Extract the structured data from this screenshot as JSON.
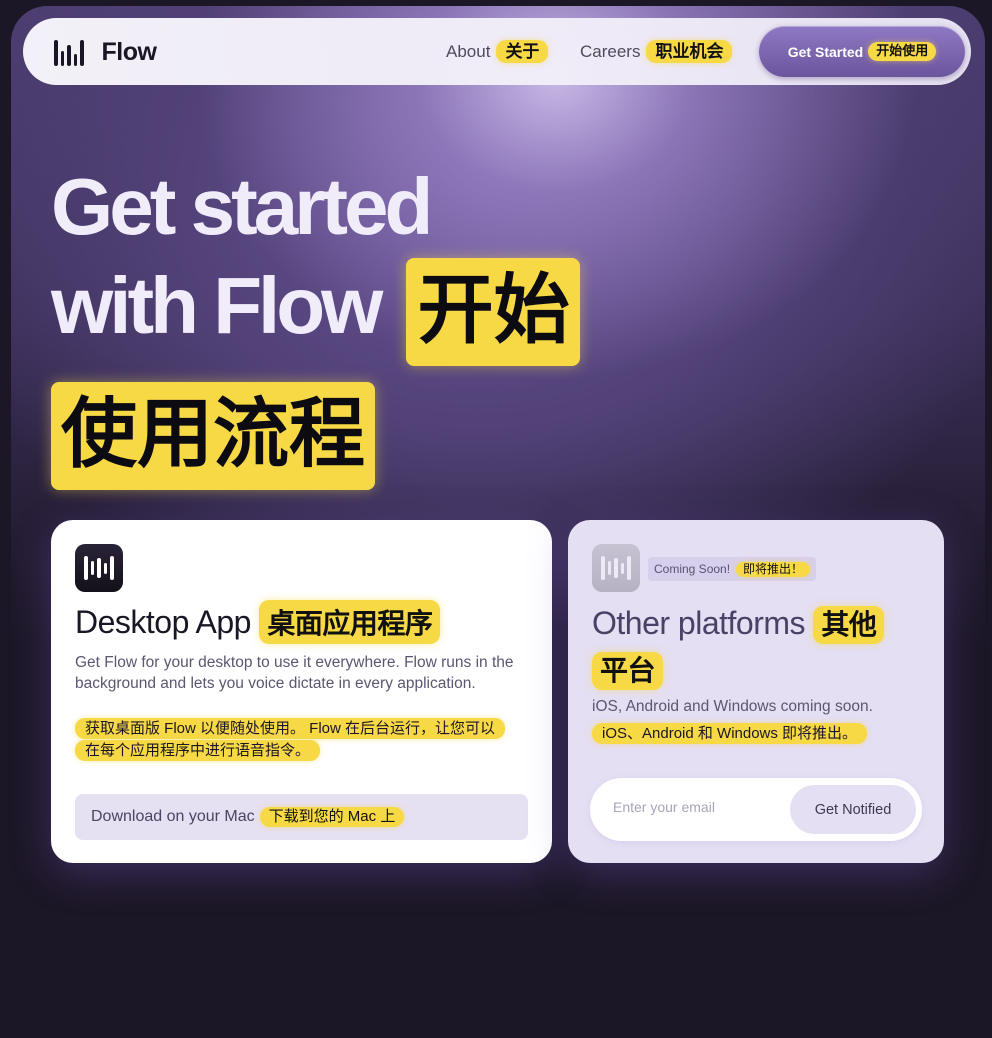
{
  "nav": {
    "brand": "Flow",
    "links": [
      {
        "label": "About",
        "zh": "关于"
      },
      {
        "label": "Careers",
        "zh": "职业机会"
      }
    ],
    "cta": {
      "label": "Get Started",
      "zh": "开始使用"
    }
  },
  "hero": {
    "line1": "Get started",
    "line2": "with Flow",
    "zh_part1": "开始",
    "zh_part2": "使用流程"
  },
  "desktop_card": {
    "title": "Desktop App",
    "title_zh": "桌面应用程序",
    "description": "Get Flow for your desktop to use it everywhere. Flow runs in the background and lets you voice dictate in every application.",
    "description_zh_1": "获取桌面版 Flow 以便随处使用。 Flow 在后台运行，让您可以",
    "description_zh_2": "在每个应用程序中进行语音指令。",
    "download_label": "Download on your Mac",
    "download_zh": "下载到您的 Mac 上"
  },
  "other_card": {
    "badge": "Coming Soon!",
    "badge_zh": "即将推出！",
    "title": "Other platforms",
    "title_zh_1": "其他",
    "title_zh_2": "平台",
    "description": "iOS, Android and Windows coming soon.",
    "description_zh": "iOS、Android 和 Windows 即将推出。",
    "email_placeholder": "Enter your email",
    "notify_label": "Get Notified"
  },
  "colors": {
    "accent_yellow": "#f7d946",
    "purple": "#6b559d",
    "background": "#1c1726"
  }
}
